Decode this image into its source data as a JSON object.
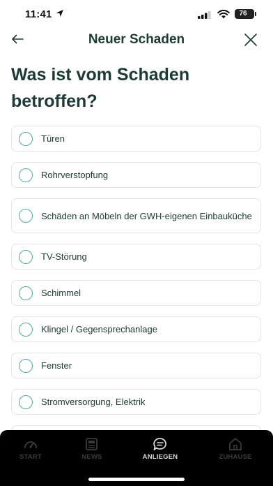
{
  "status_bar": {
    "time": "11:41",
    "battery": "76",
    "icons": [
      "location-arrow-icon",
      "signal-icon",
      "wifi-icon",
      "battery-icon"
    ]
  },
  "header": {
    "title": "Neuer Schaden",
    "back_icon": "arrow-left-icon",
    "close_icon": "close-icon"
  },
  "question": "Was ist vom Schaden betroffen?",
  "options": [
    {
      "label": "Türen"
    },
    {
      "label": "Rohrverstopfung"
    },
    {
      "label": "Schäden an Möbeln der GWH-eigenen Einbauküche"
    },
    {
      "label": "TV-Störung"
    },
    {
      "label": "Schimmel"
    },
    {
      "label": "Klingel / Gegensprechanlage"
    },
    {
      "label": "Fenster"
    },
    {
      "label": "Stromversorgung, Elektrik"
    }
  ],
  "tab_bar": {
    "tabs": [
      {
        "label": "START",
        "icon": "speedometer-icon",
        "active": false
      },
      {
        "label": "NEWS",
        "icon": "newspaper-icon",
        "active": false
      },
      {
        "label": "ANLIEGEN",
        "icon": "chat-bubble-icon",
        "active": true
      },
      {
        "label": "ZUHAUSE",
        "icon": "house-icon",
        "active": false
      }
    ]
  },
  "colors": {
    "primary_text": "#1d3b32",
    "radio_accent": "#55a89c",
    "tab_bar_bg": "#000000"
  }
}
